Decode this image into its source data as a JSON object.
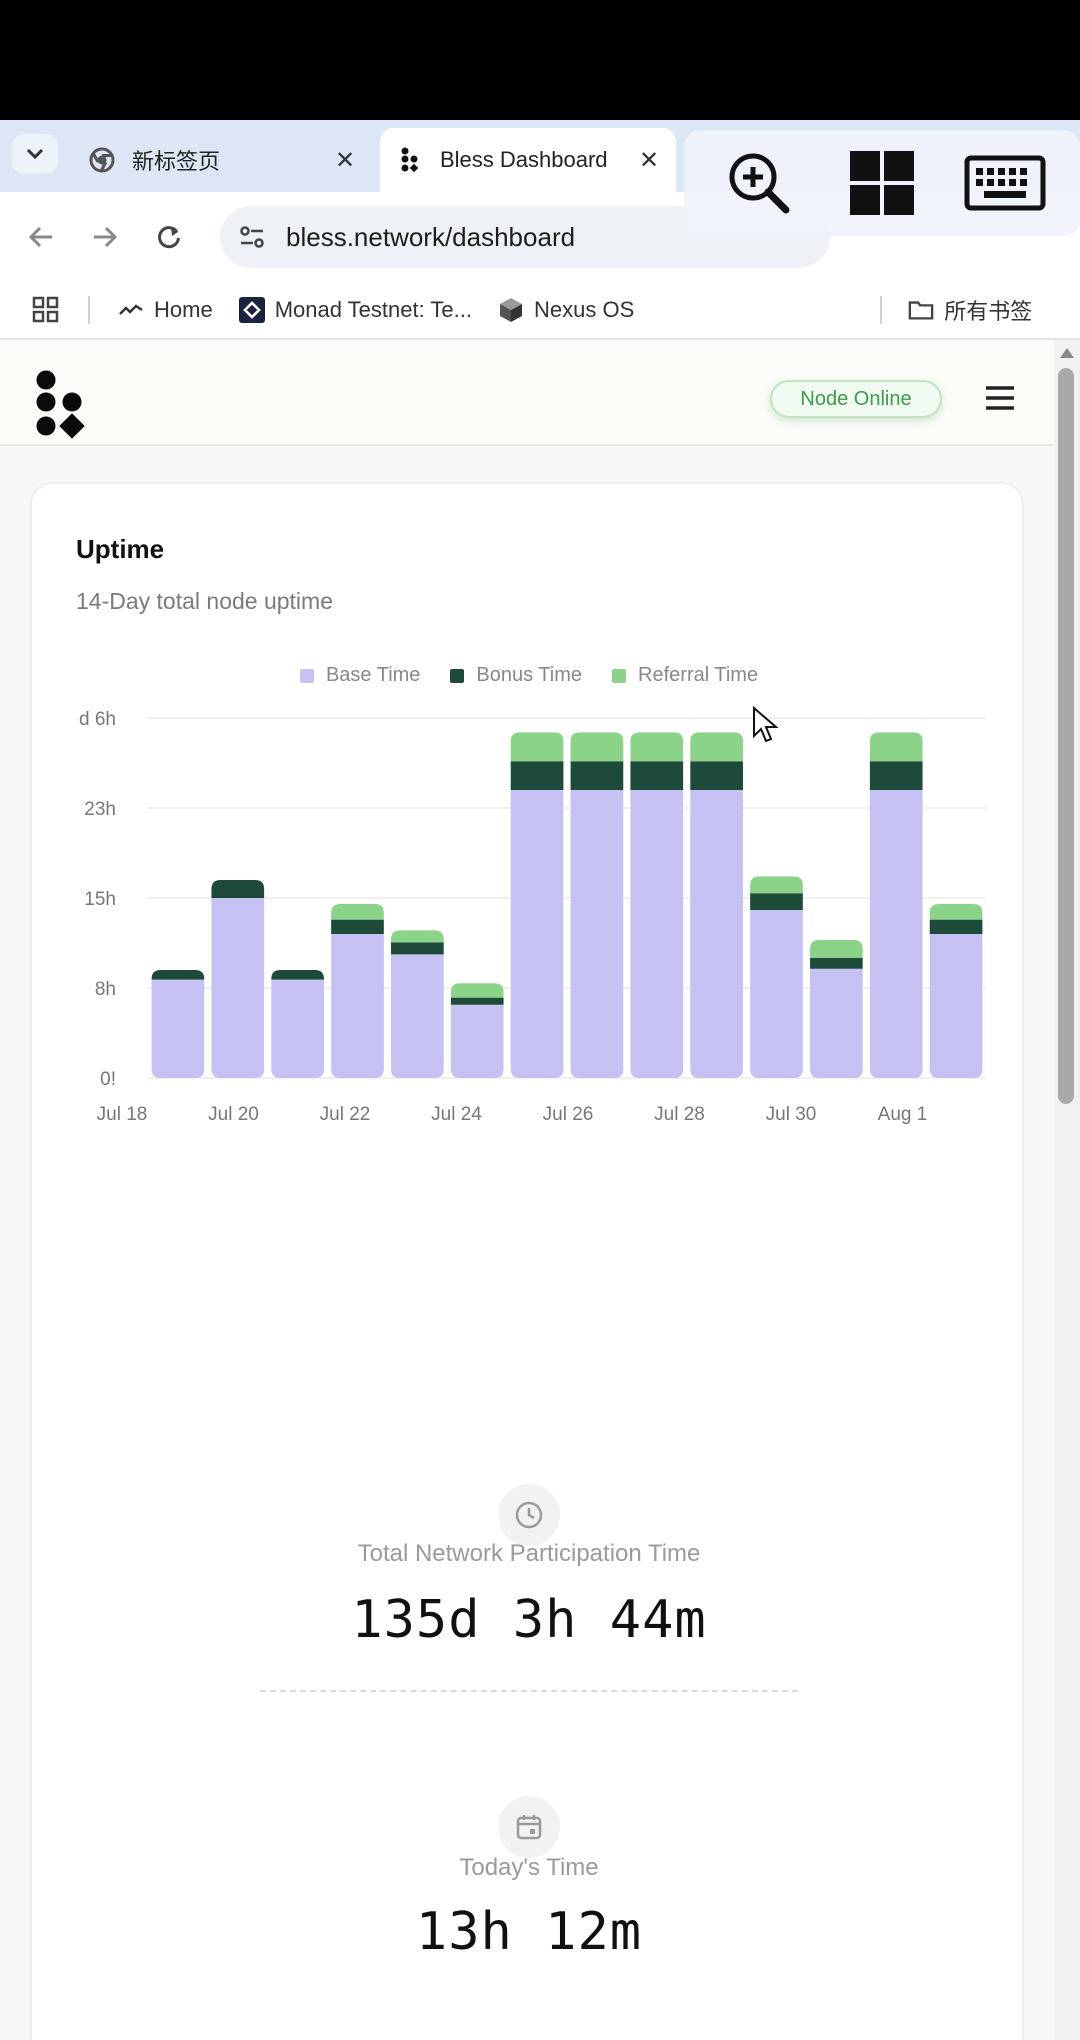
{
  "tabs": [
    {
      "label": "新标签页",
      "active": false
    },
    {
      "label": "Bless Dashboard",
      "active": true
    }
  ],
  "address": {
    "url": "bless.network/dashboard"
  },
  "bookmarks": [
    {
      "label": "Home"
    },
    {
      "label": "Monad Testnet: Te..."
    },
    {
      "label": "Nexus OS"
    }
  ],
  "bookmarks_folder": "所有书签",
  "header": {
    "status": "Node Online"
  },
  "uptime": {
    "title": "Uptime",
    "subtitle": "14-Day total node uptime"
  },
  "colors": {
    "base": "#c5c1f3",
    "bonus": "#1e4a3a",
    "referral": "#8cd38a",
    "online": "#3c9a48"
  },
  "chart_data": {
    "type": "bar",
    "stacked": true,
    "categories": [
      "Jul 18",
      "Jul 19",
      "Jul 20",
      "Jul 21",
      "Jul 22",
      "Jul 23",
      "Jul 24",
      "Jul 25",
      "Jul 26",
      "Jul 27",
      "Jul 28",
      "Jul 29",
      "Jul 30",
      "Jul 31"
    ],
    "x_tick_labels": [
      "Jul 18",
      "Jul 20",
      "Jul 22",
      "Jul 24",
      "Jul 26",
      "Jul 28",
      "Jul 30",
      "Aug 1"
    ],
    "y_tick_labels": [
      "0!",
      "8h",
      "15h",
      "23h",
      "d 6h"
    ],
    "y_ticks": [
      0,
      7.5,
      15,
      22.5,
      30
    ],
    "ylim": [
      0,
      30
    ],
    "series": [
      {
        "name": "Base Time",
        "values": [
          8.2,
          15.0,
          8.2,
          12.0,
          10.3,
          6.1,
          24.0,
          24.0,
          24.0,
          24.0,
          14.0,
          9.1,
          24.0,
          12.0
        ]
      },
      {
        "name": "Bonus Time",
        "values": [
          0.8,
          1.5,
          0.8,
          1.2,
          1.0,
          0.6,
          2.4,
          2.4,
          2.4,
          2.4,
          1.4,
          0.9,
          2.4,
          1.2
        ]
      },
      {
        "name": "Referral Time",
        "values": [
          0.0,
          0.0,
          0.0,
          1.3,
          1.0,
          1.2,
          2.4,
          2.4,
          2.4,
          2.4,
          1.4,
          1.5,
          2.4,
          1.3
        ]
      }
    ],
    "legend_position": "top-center",
    "grid": true
  },
  "stats": {
    "total_label": "Total Network Participation Time",
    "total_value": "135d 3h 44m",
    "today_label": "Today's Time",
    "today_value": "13h 12m"
  }
}
